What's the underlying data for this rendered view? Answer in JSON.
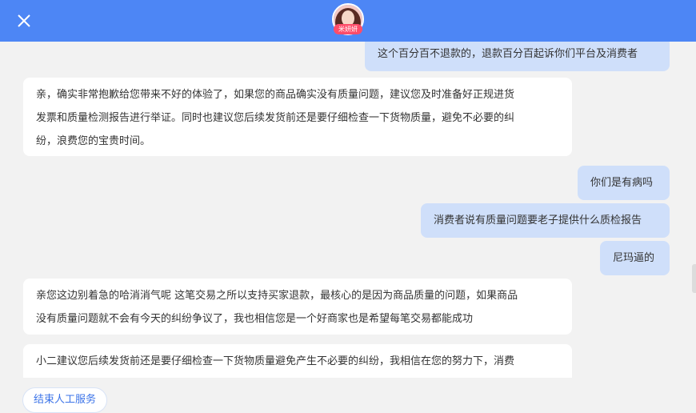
{
  "header": {
    "close_icon": "close-icon",
    "avatar_label": "米妍妍",
    "avatar_icon": "agent-avatar-icon",
    "bg_color": "#4d86f5"
  },
  "messages": [
    {
      "side": "right",
      "text": "这个百分百不退款的，退款百分百起诉你们平台及消费者"
    },
    {
      "side": "left",
      "lines": [
        "亲，确实非常抱歉给您带来不好的体验了，如果您的商品确实没有质量问题，建议您及时准备好正规进货",
        "发票和质量检测报告进行举证。同时也建议您后续发货前还是要仔细检查一下货物质量，避免不必要的纠",
        "纷，浪费您的宝贵时间。"
      ]
    },
    {
      "side": "right",
      "text": "你们是有病吗"
    },
    {
      "side": "right",
      "text": "消费者说有质量问题要老子提供什么质检报告"
    },
    {
      "side": "right",
      "text": "尼玛逼的"
    },
    {
      "side": "left",
      "lines": [
        "亲您这边别着急的哈消消气呢 这笔交易之所以支持买家退款，最核心的是因为商品质量的问题，如果商品",
        "没有质量问题就不会有今天的纠纷争议了，我也相信您是一个好商家也是希望每笔交易都能成功"
      ]
    },
    {
      "side": "left",
      "lines": [
        "小二建议您后续发货前还是要仔细检查一下货物质量避免产生不必要的纠纷，我相信在您的努力下，消费"
      ]
    }
  ],
  "footer": {
    "end_service_label": "结束人工服务"
  },
  "colors": {
    "user_bubble": "#cfdffa",
    "agent_bubble": "#ffffff",
    "background": "#f2f2f2",
    "accent": "#3b73e8"
  }
}
